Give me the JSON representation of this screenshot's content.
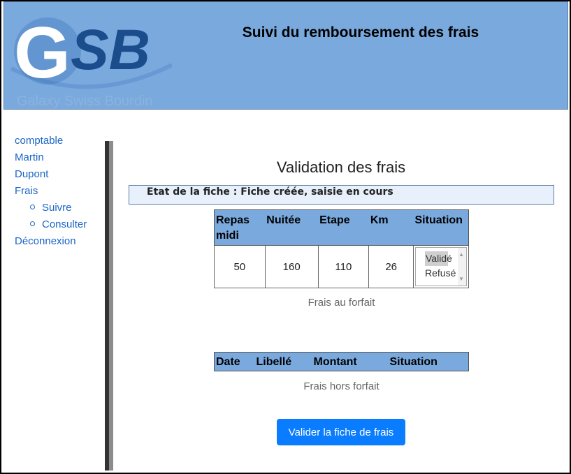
{
  "header": {
    "title": "Suivi du remboursement des frais",
    "logo_letters": "GSB",
    "logo_tagline": "Galaxy Swiss Bourdin"
  },
  "sidebar": {
    "items": [
      {
        "label": "comptable",
        "level": 0
      },
      {
        "label": "Martin",
        "level": 0
      },
      {
        "label": "Dupont",
        "level": 0
      },
      {
        "label": "Frais",
        "level": 0
      },
      {
        "label": "Suivre",
        "level": 1
      },
      {
        "label": "Consulter",
        "level": 1
      },
      {
        "label": "Déconnexion",
        "level": 0
      }
    ]
  },
  "main": {
    "title": "Validation des frais",
    "etat": "Etat de la fiche : Fiche créée, saisie en cours",
    "forfait": {
      "headers": [
        "Repas midi",
        "Nuitée",
        "Etape",
        "Km",
        "Situation"
      ],
      "values": [
        "50",
        "160",
        "110",
        "26"
      ],
      "situation_options": [
        "Validé",
        "Refusé"
      ],
      "selected": "Validé",
      "caption": "Frais au forfait"
    },
    "hors_forfait": {
      "headers": [
        "Date",
        "Libellé",
        "Montant",
        "Situation"
      ],
      "caption": "Frais hors forfait"
    },
    "submit_label": "Valider la fiche de frais"
  },
  "colors": {
    "header_bg": "#7aa9de",
    "link": "#1a66c6",
    "button": "#0a7cff",
    "etat_bg": "#e8f0fb"
  }
}
